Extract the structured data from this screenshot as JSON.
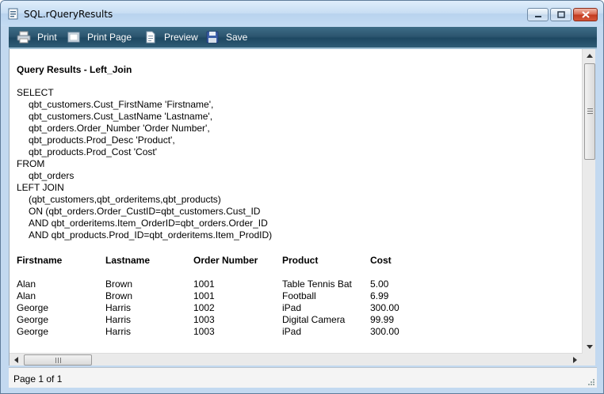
{
  "window": {
    "title": "SQL.rQueryResults"
  },
  "toolbar": {
    "print": "Print",
    "print_page": "Print Page",
    "preview": "Preview",
    "save": "Save"
  },
  "report": {
    "title": "Query Results - Left_Join",
    "sql": [
      {
        "text": "SELECT",
        "indent": false
      },
      {
        "text": "qbt_customers.Cust_FirstName 'Firstname',",
        "indent": true
      },
      {
        "text": "qbt_customers.Cust_LastName 'Lastname',",
        "indent": true
      },
      {
        "text": "qbt_orders.Order_Number 'Order Number',",
        "indent": true
      },
      {
        "text": "qbt_products.Prod_Desc 'Product',",
        "indent": true
      },
      {
        "text": "qbt_products.Prod_Cost 'Cost'",
        "indent": true
      },
      {
        "text": "FROM",
        "indent": false
      },
      {
        "text": "qbt_orders",
        "indent": true
      },
      {
        "text": "LEFT JOIN",
        "indent": false
      },
      {
        "text": "(qbt_customers,qbt_orderitems,qbt_products)",
        "indent": true
      },
      {
        "text": "ON (qbt_orders.Order_CustID=qbt_customers.Cust_ID",
        "indent": true
      },
      {
        "text": "AND qbt_orderitems.Item_OrderID=qbt_orders.Order_ID",
        "indent": true
      },
      {
        "text": "AND qbt_products.Prod_ID=qbt_orderitems.Item_ProdID)",
        "indent": true
      }
    ],
    "columns": [
      "Firstname",
      "Lastname",
      "Order Number",
      "Product",
      "Cost"
    ],
    "rows": [
      [
        "Alan",
        "Brown",
        "1001",
        "Table Tennis Bat",
        "5.00"
      ],
      [
        "Alan",
        "Brown",
        "1001",
        "Football",
        "6.99"
      ],
      [
        "George",
        "Harris",
        "1002",
        "iPad",
        "300.00"
      ],
      [
        "George",
        "Harris",
        "1003",
        "Digital Camera",
        "99.99"
      ],
      [
        "George",
        "Harris",
        "1003",
        "iPad",
        "300.00"
      ]
    ]
  },
  "status": {
    "page": "Page 1 of 1"
  }
}
